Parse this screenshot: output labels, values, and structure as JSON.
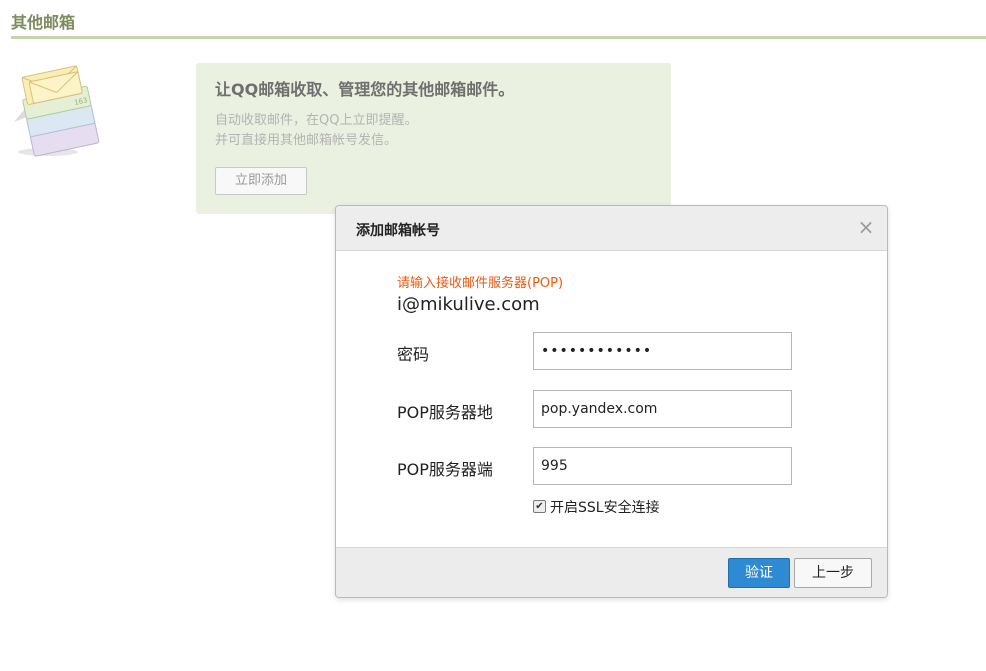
{
  "page": {
    "title": "其他邮箱"
  },
  "promo": {
    "heading": "让QQ邮箱收取、管理您的其他邮箱邮件。",
    "line1": "自动收取邮件，在QQ上立即提醒。",
    "line2": "并可直接用其他邮箱帐号发信。",
    "add_button": "立即添加",
    "illustration_icon": "mailbox-stack-icon"
  },
  "dialog": {
    "title": "添加邮箱帐号",
    "close_icon": "close-icon",
    "close_glyph": "×",
    "hint": "请输入接收邮件服务器(POP)",
    "email": "i@mikulive.com",
    "password_label": "密码",
    "password_value": "••••••••••••",
    "server_label": "POP服务器地",
    "server_value": "pop.yandex.com",
    "port_label": "POP服务器端",
    "port_value": "995",
    "ssl_checked": true,
    "ssl_check_glyph": "✔",
    "ssl_label": "开启SSL安全连接",
    "verify_button": "验证",
    "prev_button": "上一步"
  },
  "colors": {
    "accent": "#2e8ad2",
    "title_green": "#7d8c5c",
    "panel_bg": "#ebf1e1",
    "hint_orange": "#ee5a12"
  }
}
